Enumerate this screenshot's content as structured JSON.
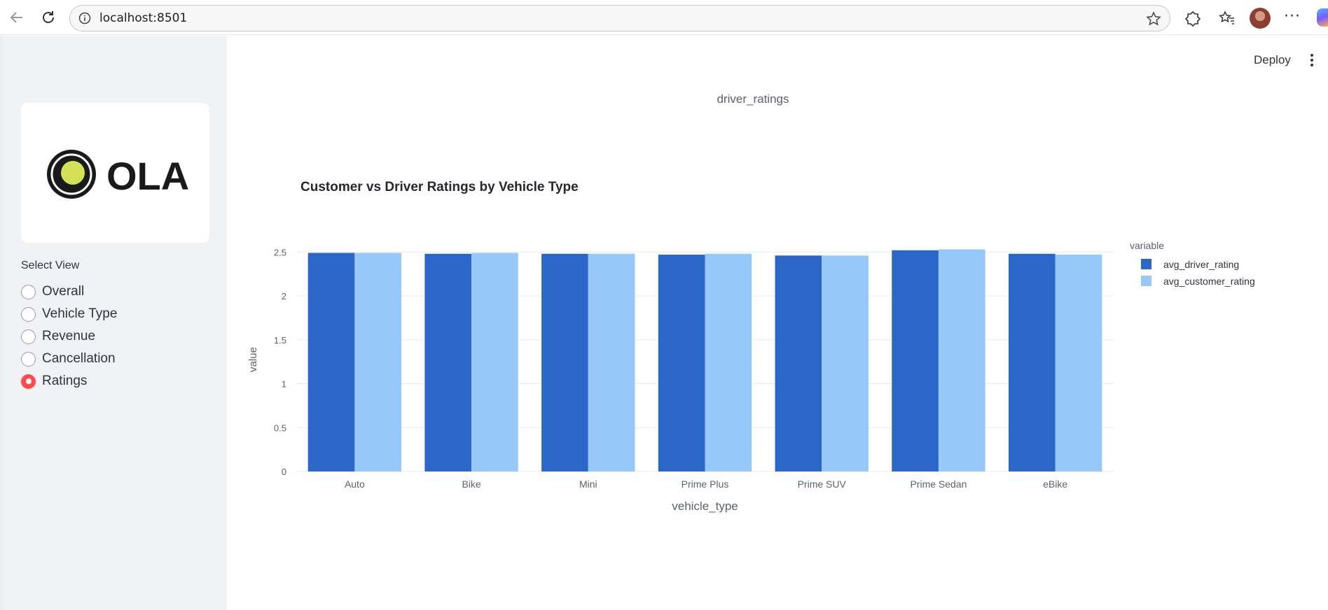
{
  "browser": {
    "url": "localhost:8501",
    "icons": [
      "back-arrow-icon",
      "refresh-icon",
      "info-icon",
      "star-icon",
      "extensions-icon",
      "favorites-icon",
      "profile-avatar",
      "more-icon",
      "copilot-icon"
    ]
  },
  "header": {
    "deploy_label": "Deploy"
  },
  "sidebar": {
    "logo_text": "OLA",
    "select_label": "Select View",
    "options": [
      {
        "label": "Overall",
        "selected": false
      },
      {
        "label": "Vehicle Type",
        "selected": false
      },
      {
        "label": "Revenue",
        "selected": false
      },
      {
        "label": "Cancellation",
        "selected": false
      },
      {
        "label": "Ratings",
        "selected": true
      }
    ],
    "accent_color": "#ff4b4b"
  },
  "main": {
    "section_title": "driver_ratings",
    "chart_title": "Customer vs Driver Ratings by Vehicle Type"
  },
  "chart_data": {
    "type": "bar",
    "title": "Customer vs Driver Ratings by Vehicle Type",
    "xlabel": "vehicle_type",
    "ylabel": "value",
    "ylim": [
      0,
      2.5
    ],
    "yticks": [
      "0",
      "0.5",
      "1",
      "1.5",
      "2",
      "2.5"
    ],
    "grid": true,
    "legend_title": "variable",
    "legend_position": "top-right",
    "categories": [
      "Auto",
      "Bike",
      "Mini",
      "Prime Plus",
      "Prime SUV",
      "Prime Sedan",
      "eBike"
    ],
    "series": [
      {
        "name": "avg_driver_rating",
        "color": "#2b67c6",
        "values": [
          2.49,
          2.48,
          2.48,
          2.47,
          2.46,
          2.52,
          2.48
        ]
      },
      {
        "name": "avg_customer_rating",
        "color": "#97c8fa",
        "values": [
          2.49,
          2.49,
          2.48,
          2.48,
          2.46,
          2.53,
          2.47
        ]
      }
    ]
  }
}
